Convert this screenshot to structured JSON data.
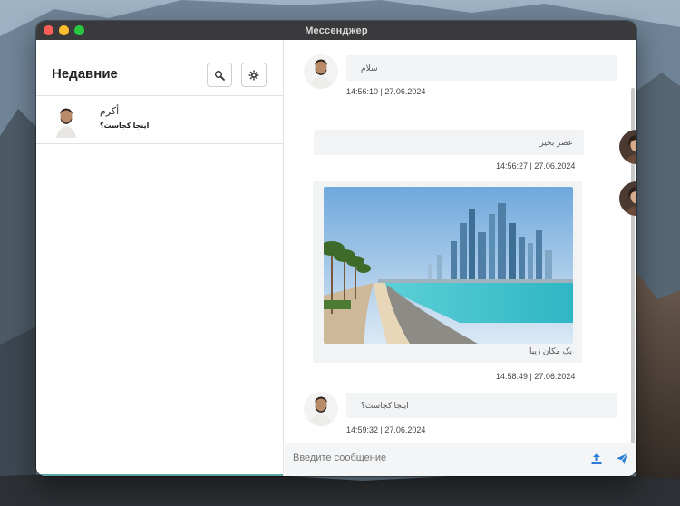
{
  "window": {
    "title": "Мессенджер"
  },
  "sidebar": {
    "title": "Недавние",
    "search_icon": "magnifier-icon",
    "settings_icon": "gear-icon",
    "contacts": [
      {
        "name": "أكرم",
        "last_message": "اینجا کجاست؟"
      }
    ]
  },
  "chat": {
    "messages": [
      {
        "from": "contact",
        "text": "سلام",
        "time": "14:56:10 | 27.06.2024"
      },
      {
        "from": "me",
        "text": "عصر بخیر",
        "time": "14:56:27 | 27.06.2024"
      },
      {
        "from": "me",
        "type": "image",
        "caption": "یک مکان زیبا",
        "time": "14:58:49 | 27.06.2024"
      },
      {
        "from": "contact",
        "text": "اینجا کجاست؟",
        "time": "14:59:32 | 27.06.2024"
      }
    ]
  },
  "composer": {
    "placeholder": "Введите сообщение",
    "upload_icon": "upload-icon",
    "send_icon": "send-icon"
  },
  "colors": {
    "accent": "#2b7cd3",
    "bubble": "#f2f3f5",
    "titlebar": "#3a3a3c"
  }
}
